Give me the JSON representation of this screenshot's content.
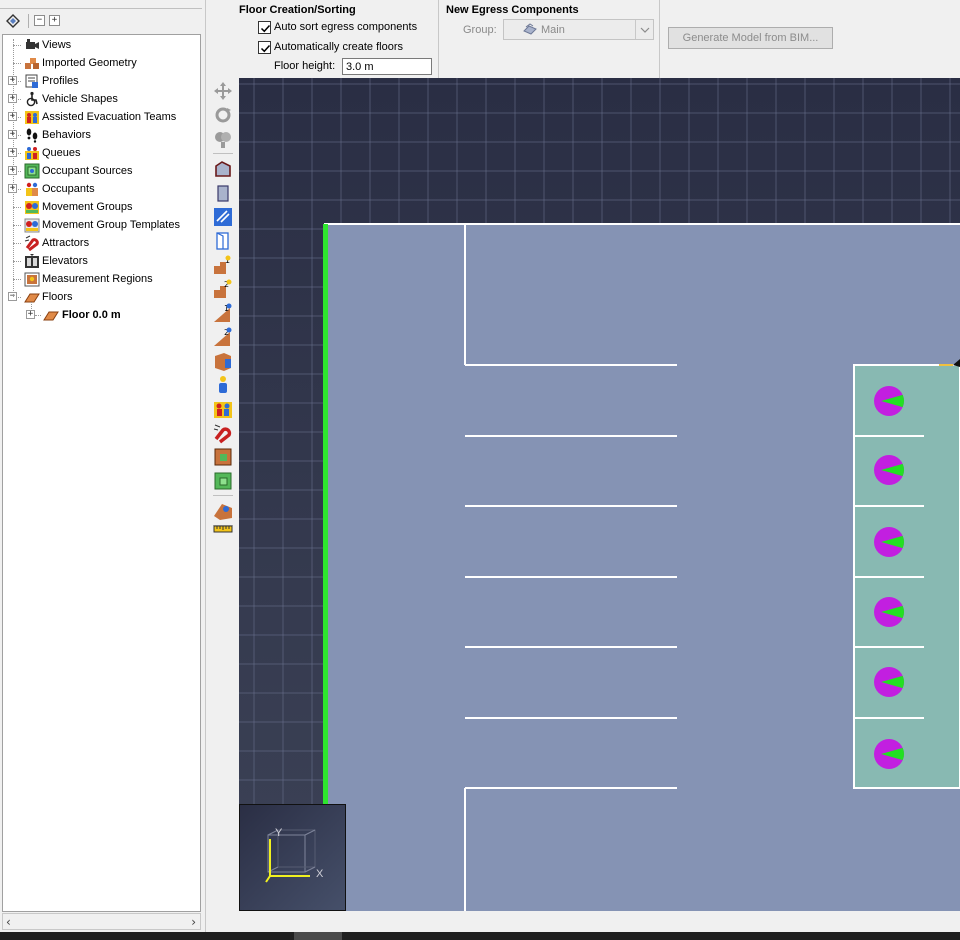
{
  "navigator": {
    "tree": [
      {
        "label": "Views",
        "icon": "camera-icon",
        "expandable": false
      },
      {
        "label": "Imported Geometry",
        "icon": "imported-geometry-icon",
        "expandable": false
      },
      {
        "label": "Profiles",
        "icon": "profiles-icon",
        "expandable": true
      },
      {
        "label": "Vehicle Shapes",
        "icon": "wheelchair-icon",
        "expandable": true
      },
      {
        "label": "Assisted Evacuation Teams",
        "icon": "team-icon",
        "expandable": true
      },
      {
        "label": "Behaviors",
        "icon": "footprints-icon",
        "expandable": true
      },
      {
        "label": "Queues",
        "icon": "queue-icon",
        "expandable": true
      },
      {
        "label": "Occupant Sources",
        "icon": "occupant-source-icon",
        "expandable": true
      },
      {
        "label": "Occupants",
        "icon": "occupants-icon",
        "expandable": true
      },
      {
        "label": "Movement Groups",
        "icon": "movement-group-icon",
        "expandable": false
      },
      {
        "label": "Movement Group Templates",
        "icon": "movement-template-icon",
        "expandable": false
      },
      {
        "label": "Attractors",
        "icon": "magnet-icon",
        "expandable": false
      },
      {
        "label": "Elevators",
        "icon": "elevator-icon",
        "expandable": false
      },
      {
        "label": "Measurement Regions",
        "icon": "measurement-region-icon",
        "expandable": false
      },
      {
        "label": "Floors",
        "icon": "floor-icon",
        "expandable": true,
        "expanded": true
      }
    ],
    "floor_child": {
      "label": "Floor 0.0 m",
      "icon": "floor-icon"
    }
  },
  "floor_creation": {
    "title": "Floor Creation/Sorting",
    "auto_sort_label": "Auto sort egress components",
    "auto_sort_checked": true,
    "auto_create_label": "Automatically create floors",
    "auto_create_checked": true,
    "floor_height_label": "Floor height:",
    "floor_height_value": "3.0 m"
  },
  "new_egress": {
    "title": "New Egress Components",
    "group_label": "Group:",
    "group_value": "Main"
  },
  "generate_button": "Generate Model from BIM...",
  "axes": {
    "x": "X",
    "y": "Y"
  },
  "colors": {
    "background_dark": "#2c3147",
    "room_fill": "#8593b4",
    "stair_fill": "#88b9b2",
    "wall": "#ffffff",
    "door": "#2ee62e",
    "occupant_body": "#c21fe0",
    "occupant_heading": "#22e022",
    "selection": "#f0c040"
  },
  "occupant_count": 6
}
